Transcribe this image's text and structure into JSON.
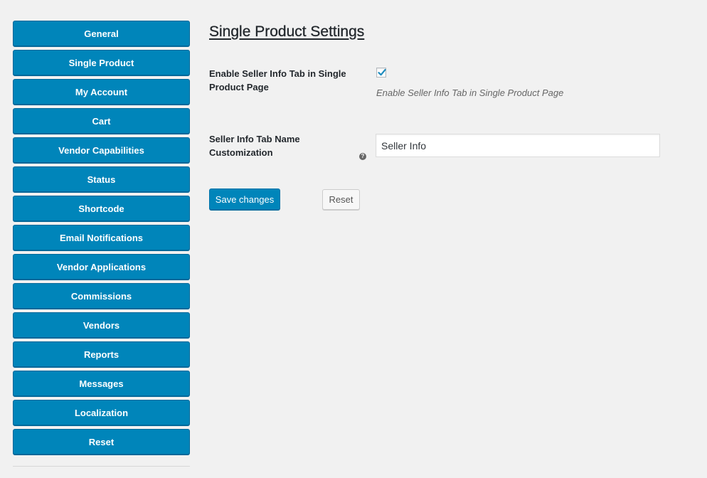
{
  "sidebar": {
    "items": [
      {
        "label": "General"
      },
      {
        "label": "Single Product"
      },
      {
        "label": "My Account"
      },
      {
        "label": "Cart"
      },
      {
        "label": "Vendor Capabilities"
      },
      {
        "label": "Status"
      },
      {
        "label": "Shortcode"
      },
      {
        "label": "Email Notifications"
      },
      {
        "label": "Vendor Applications"
      },
      {
        "label": "Commissions"
      },
      {
        "label": "Vendors"
      },
      {
        "label": "Reports"
      },
      {
        "label": "Messages"
      },
      {
        "label": "Localization"
      },
      {
        "label": "Reset"
      }
    ]
  },
  "main": {
    "title": "Single Product Settings",
    "seller_tab": {
      "label": "Enable Seller Info Tab in Single Product Page",
      "checked": true,
      "description": "Enable Seller Info Tab in Single Product Page"
    },
    "tab_name": {
      "label": "Seller Info Tab Name Customization",
      "help_icon": "question-circle-icon",
      "help_glyph": "?",
      "value": "Seller Info"
    },
    "buttons": {
      "save_label": "Save changes",
      "reset_label": "Reset"
    }
  },
  "colors": {
    "primary": "#0085ba",
    "background": "#f1f1f1",
    "checkmark": "#1e8cbe"
  }
}
